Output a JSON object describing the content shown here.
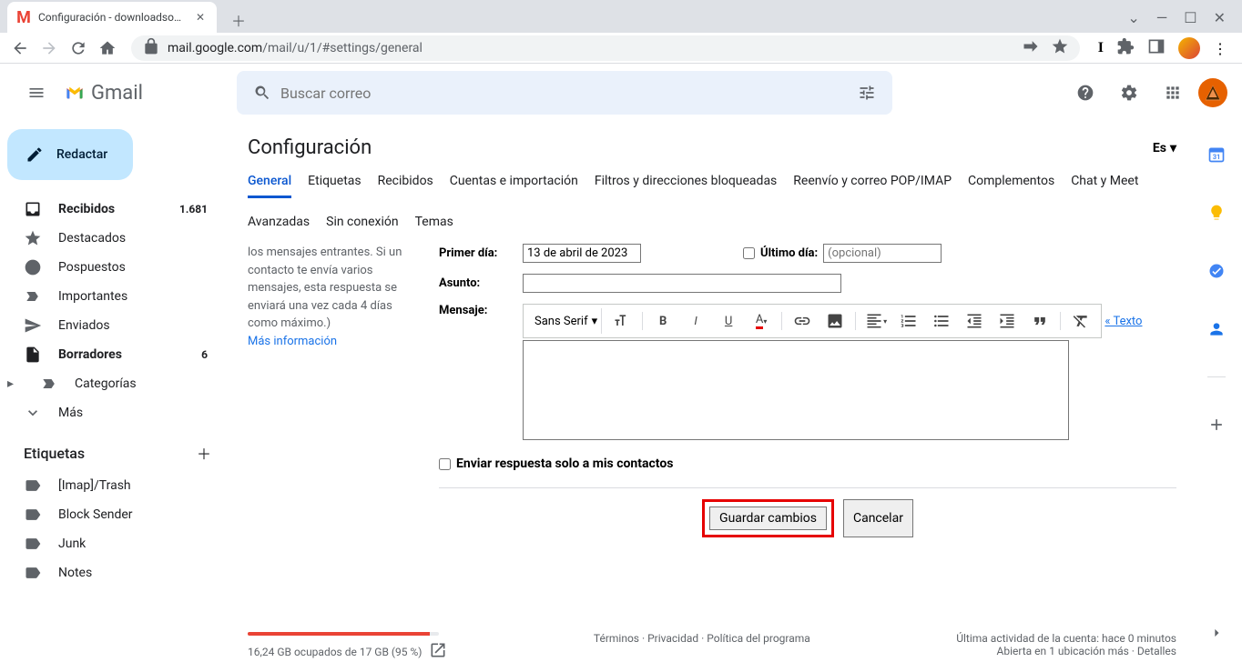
{
  "browser": {
    "tab_title": "Configuración - downloadsource",
    "url_host": "mail.google.com",
    "url_path": "/mail/u/1/#settings/general"
  },
  "header": {
    "app_name": "Gmail",
    "search_placeholder": "Buscar correo"
  },
  "compose_label": "Redactar",
  "nav": [
    {
      "label": "Recibidos",
      "count": "1.681",
      "bold": true,
      "icon": "inbox"
    },
    {
      "label": "Destacados",
      "icon": "star"
    },
    {
      "label": "Pospuestos",
      "icon": "clock"
    },
    {
      "label": "Importantes",
      "icon": "important"
    },
    {
      "label": "Enviados",
      "icon": "send"
    },
    {
      "label": "Borradores",
      "count": "6",
      "bold": true,
      "icon": "draft"
    },
    {
      "label": "Categorías",
      "icon": "category",
      "expandable": true
    },
    {
      "label": "Más",
      "icon": "more"
    }
  ],
  "labels_header": "Etiquetas",
  "labels": [
    {
      "label": "[Imap]/Trash"
    },
    {
      "label": "Block Sender"
    },
    {
      "label": "Junk"
    },
    {
      "label": "Notes"
    }
  ],
  "settings": {
    "title": "Configuración",
    "lang": "Es",
    "tabs": [
      "General",
      "Etiquetas",
      "Recibidos",
      "Cuentas e importación",
      "Filtros y direcciones bloqueadas",
      "Reenvío y correo POP/IMAP",
      "Complementos",
      "Chat y Meet",
      "Avanzadas",
      "Sin conexión",
      "Temas"
    ],
    "active_tab": 0,
    "help_text": "los mensajes entrantes. Si un contacto te envía varios mensajes, esta respuesta se enviará una vez cada 4 días como máximo.)",
    "help_link": "Más información",
    "first_day_label": "Primer día:",
    "first_day_value": "13 de abril de 2023",
    "last_day_label": "Último día:",
    "last_day_placeholder": "(opcional)",
    "subject_label": "Asunto:",
    "message_label": "Mensaje:",
    "font_name": "Sans Serif",
    "plain_text_link": "«  Texto",
    "only_contacts": "Enviar respuesta solo a mis contactos",
    "save_btn": "Guardar cambios",
    "cancel_btn": "Cancelar"
  },
  "footer": {
    "storage_pct": 95,
    "storage_text": "16,24 GB ocupados de 17 GB (95 %)",
    "terms": "Términos",
    "privacy": "Privacidad",
    "policy": "Política del programa",
    "activity": "Última actividad de la cuenta: hace 0 minutos",
    "open_in": "Abierta en 1 ubicación más",
    "details": "Detalles"
  }
}
